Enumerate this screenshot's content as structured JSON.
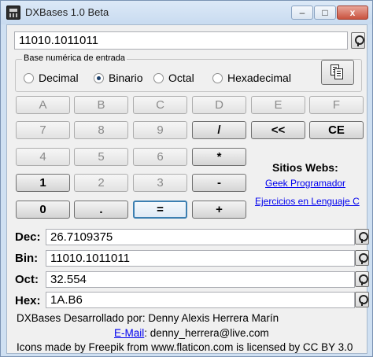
{
  "window": {
    "title": "DXBases 1.0 Beta",
    "controls": {
      "minimize": "–",
      "maximize": "□",
      "close": "x"
    }
  },
  "input": {
    "value": "11010.1011011"
  },
  "base_group": {
    "label": "Base numérica de entrada",
    "options": [
      "Decimal",
      "Binario",
      "Octal",
      "Hexadecimal"
    ],
    "selected": "Binario"
  },
  "keys": {
    "A": "A",
    "B": "B",
    "C": "C",
    "D": "D",
    "E": "E",
    "F": "F",
    "7": "7",
    "8": "8",
    "9": "9",
    "div": "/",
    "back": "<<",
    "ce": "CE",
    "4": "4",
    "5": "5",
    "6": "6",
    "mul": "*",
    "1": "1",
    "2": "2",
    "3": "3",
    "sub": "-",
    "0": "0",
    "dot": ".",
    "eq": "=",
    "add": "+"
  },
  "sites": {
    "title": "Sitios Webs:",
    "links": [
      "Geek Programador",
      "Ejercicios en Lenguaje C"
    ]
  },
  "results": {
    "dec": {
      "label": "Dec:",
      "value": "26.7109375"
    },
    "bin": {
      "label": "Bin:",
      "value": "11010.1011011"
    },
    "oct": {
      "label": "Oct:",
      "value": "32.554"
    },
    "hex": {
      "label": "Hex:",
      "value": "1A.B6"
    }
  },
  "footer": {
    "developer": "DXBases Desarrollado por: Denny Alexis Herrera Marín",
    "email_label": "E-Mail",
    "email_value": ": denny_herrera@live.com",
    "credits": "Icons made by Freepik from www.flaticon.com is licensed by CC BY 3.0"
  },
  "colors": {
    "frame": "#cfe0f2",
    "client": "#f0f0f0",
    "link": "#0000ee",
    "focus_border": "#3c7fb1",
    "close_button": "#c9533f"
  }
}
